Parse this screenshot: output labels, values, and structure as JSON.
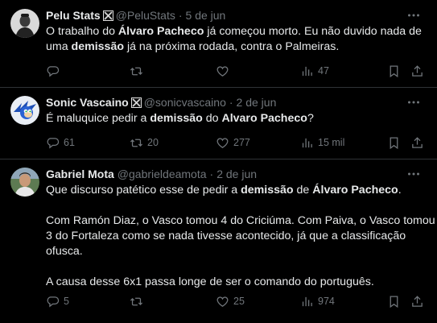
{
  "tweets": [
    {
      "name": "Pelu Stats",
      "handle": "@PeluStats",
      "date": "5 de jun",
      "lines": [
        [
          {
            "t": "O trabalho do "
          },
          {
            "t": "Álvaro Pacheco",
            "b": true
          },
          {
            "t": " já começou morto. Eu não duvido nada de"
          }
        ],
        [
          {
            "t": "uma "
          },
          {
            "t": "demissão",
            "b": true
          },
          {
            "t": " já na próxima rodada, contra o Palmeiras."
          }
        ]
      ],
      "stats": {
        "replies": "",
        "retweets": "",
        "likes": "",
        "views": "47"
      }
    },
    {
      "name": "Sonic Vascaino",
      "handle": "@sonicvascaino",
      "date": "2 de jun",
      "lines": [
        [
          {
            "t": "É maluquice pedir a "
          },
          {
            "t": "demissão",
            "b": true
          },
          {
            "t": " do "
          },
          {
            "t": "Alvaro Pacheco",
            "b": true
          },
          {
            "t": "?"
          }
        ]
      ],
      "stats": {
        "replies": "61",
        "retweets": "20",
        "likes": "277",
        "views": "15 mil"
      }
    },
    {
      "name": "Gabriel Mota",
      "handle": "@gabrieldeamota",
      "date": "2 de jun",
      "lines": [
        [
          {
            "t": "Que discurso patético esse de pedir a "
          },
          {
            "t": "demissão",
            "b": true
          },
          {
            "t": " de "
          },
          {
            "t": "Álvaro Pacheco",
            "b": true
          },
          {
            "t": "."
          }
        ],
        [],
        [
          {
            "t": "Com Ramón Diaz, o Vasco tomou 4 do Criciúma. Com Paiva, o Vasco tomou"
          }
        ],
        [
          {
            "t": "3 do Fortaleza como se nada tivesse acontecido, já que a classificação"
          }
        ],
        [
          {
            "t": "ofusca."
          }
        ],
        [],
        [
          {
            "t": "A causa desse 6x1 passa longe de ser o comando do português."
          }
        ]
      ],
      "stats": {
        "replies": "5",
        "retweets": "",
        "likes": "25",
        "views": "974"
      }
    }
  ],
  "separator": "·",
  "colors": {
    "background": "#000000",
    "text": "#e7e9ea",
    "muted": "#71767b",
    "divider": "#2f3336"
  },
  "icons": [
    "vasco-badge-icon",
    "more-icon",
    "reply-icon",
    "retweet-icon",
    "like-icon",
    "views-icon",
    "bookmark-icon",
    "share-icon"
  ]
}
